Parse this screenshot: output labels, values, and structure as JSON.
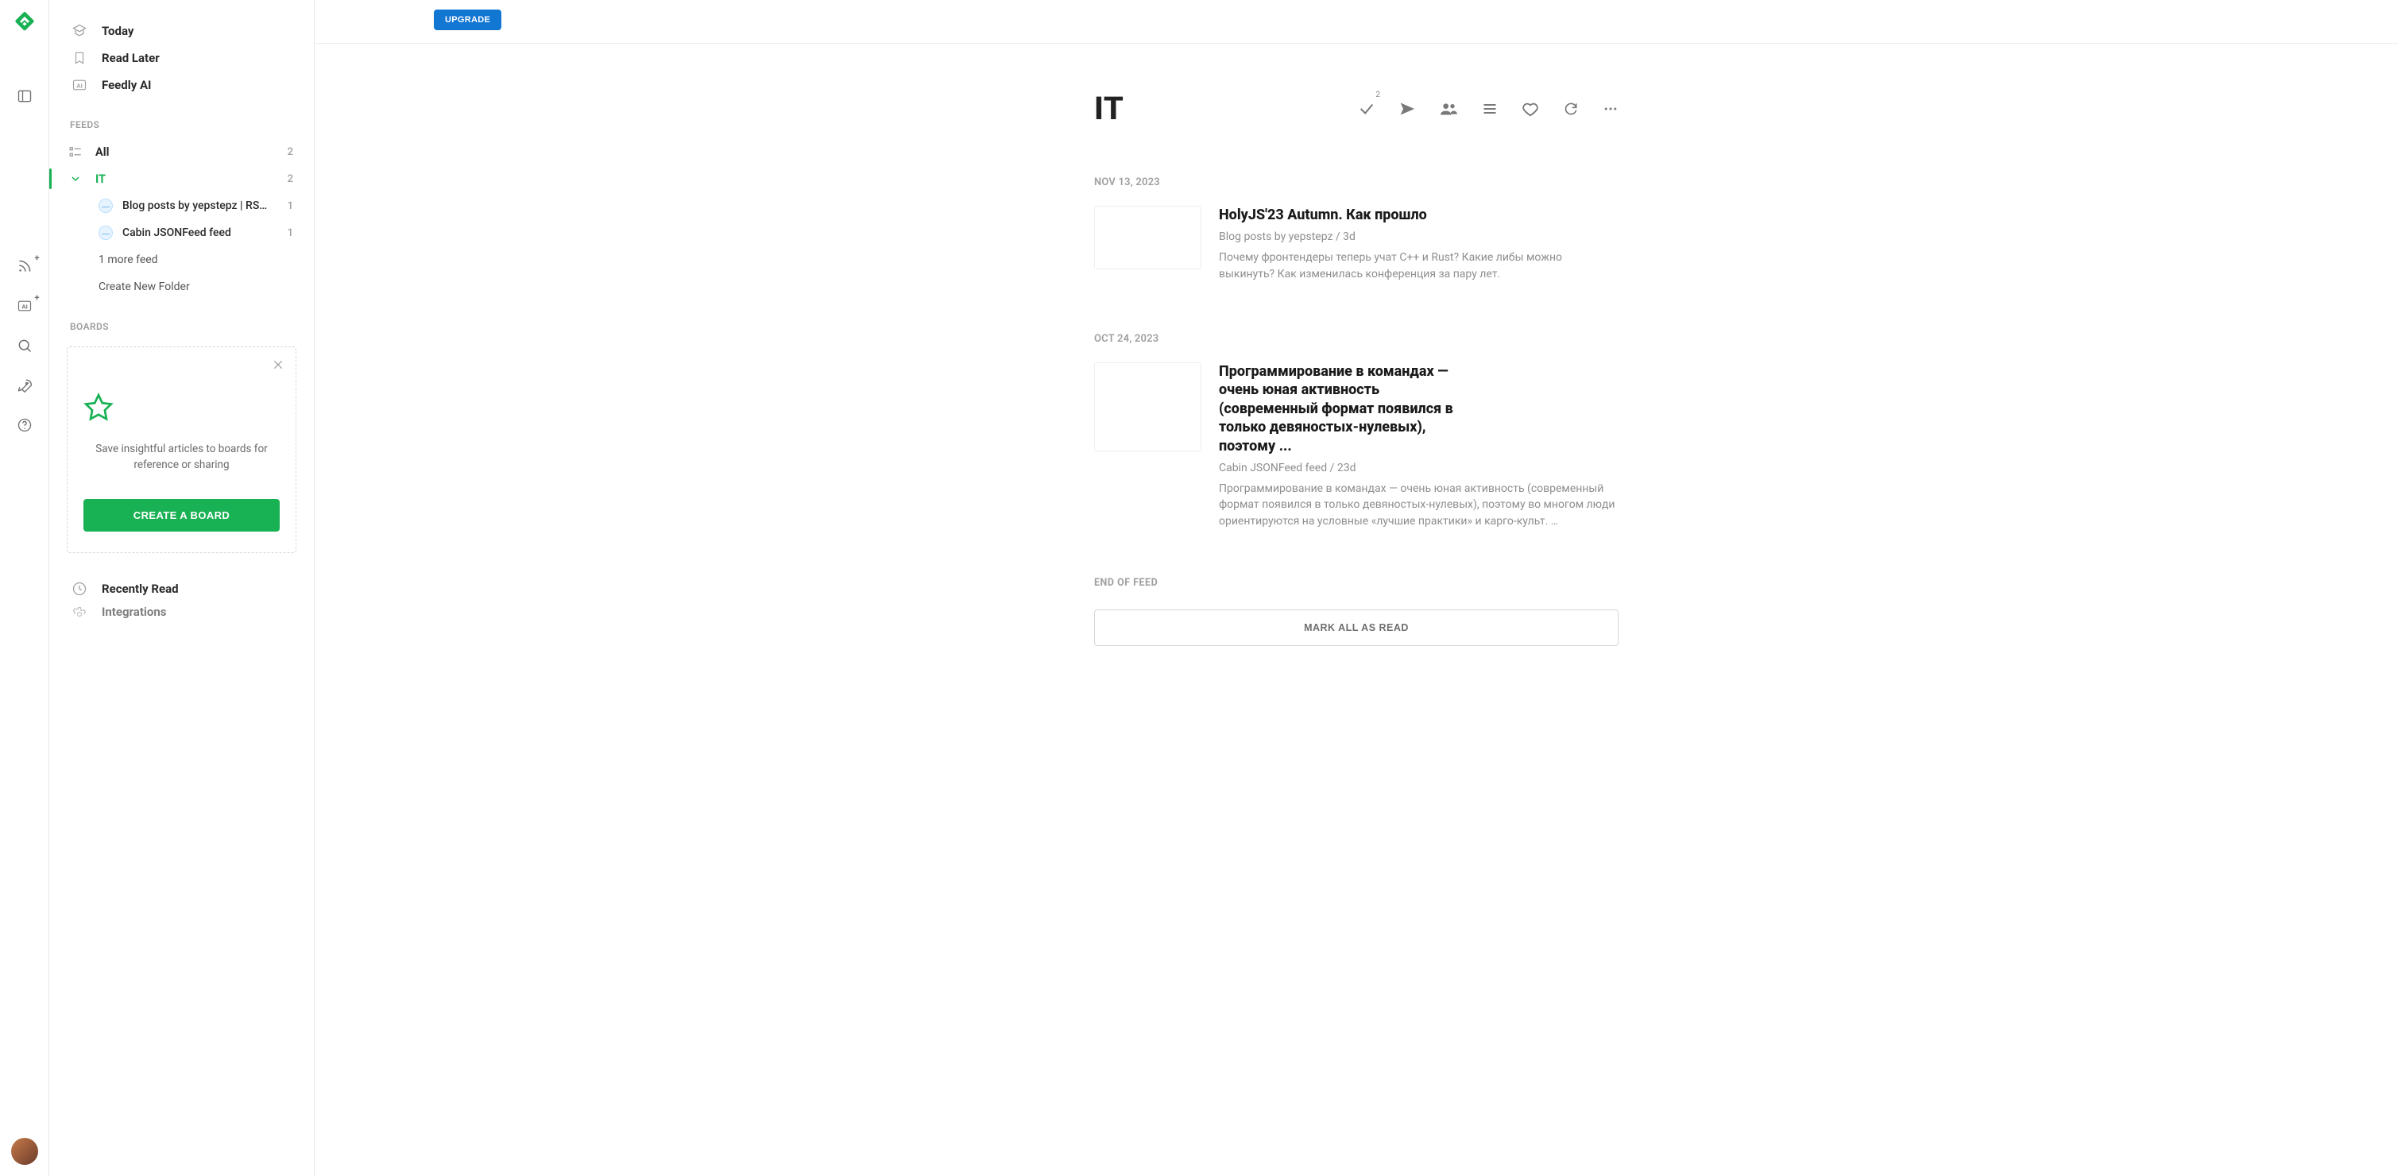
{
  "rail": {
    "logo_color": "#18b154"
  },
  "sidebar": {
    "nav": {
      "today": "Today",
      "read_later": "Read Later",
      "feedly_ai": "Feedly AI"
    },
    "feeds_label": "FEEDS",
    "all": {
      "label": "All",
      "count": "2"
    },
    "folder": {
      "label": "IT",
      "count": "2"
    },
    "children": [
      {
        "label": "Blog posts by yepstepz | RS…",
        "count": "1"
      },
      {
        "label": "Cabin JSONFeed feed",
        "count": "1"
      }
    ],
    "more_feed": "1 more feed",
    "create_folder": "Create New Folder",
    "boards_label": "BOARDS",
    "boards_card": {
      "message": "Save insightful articles to boards for reference or sharing",
      "button": "CREATE A BOARD"
    },
    "recently_read": "Recently Read",
    "integrations": "Integrations"
  },
  "main": {
    "upgrade": "UPGRADE",
    "title": "IT",
    "mark_count": "2",
    "groups": [
      {
        "date": "NOV 13, 2023",
        "article": {
          "title": "HolyJS'23 Autumn. Как прошло",
          "source": "Blog posts by yepstepz",
          "age": "3d",
          "excerpt": "Почему фронтендеры теперь учат C++ и Rust? Какие либы можно выкинуть? Как изменилась конференция за пару лет."
        }
      },
      {
        "date": "OCT 24, 2023",
        "article": {
          "title": "Программирование в командах — очень юная активность (современный формат появился в только девяностых-нулевых), поэтому ...",
          "source": "Cabin JSONFeed feed",
          "age": "23d",
          "excerpt": "Программирование в командах — очень юная активность (современный формат появился в только девяностых-нулевых), поэтому во многом люди ориентируются на условные «лучшие практики» и карго-культ. …"
        }
      }
    ],
    "end_of_feed": "END OF FEED",
    "mark_all": "MARK ALL AS READ"
  }
}
